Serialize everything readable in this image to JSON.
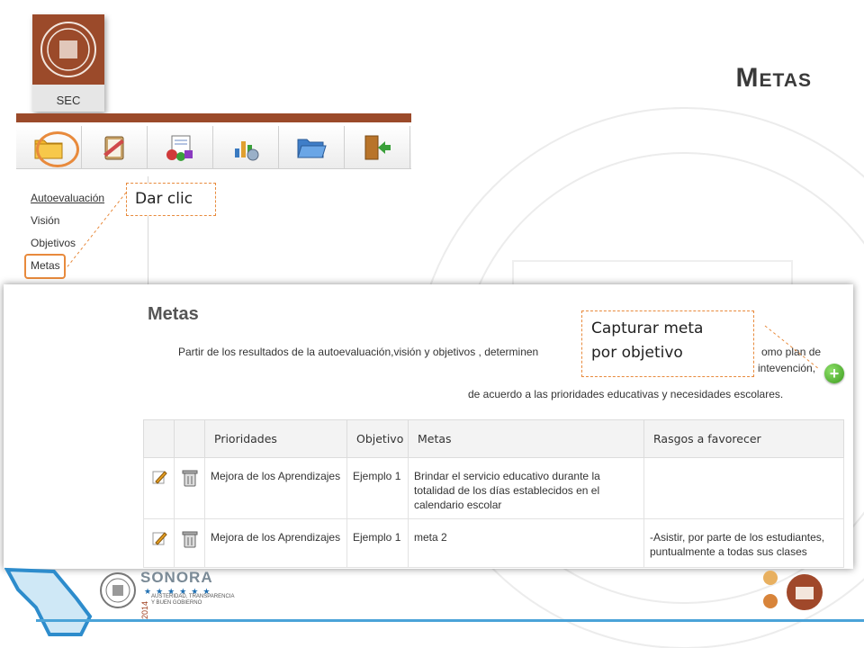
{
  "slide": {
    "title": "Metas"
  },
  "logo": {
    "label": "SEC"
  },
  "toolbar": {
    "items": [
      {
        "icon": "folder-icon",
        "active": true
      },
      {
        "icon": "clipboard-icon"
      },
      {
        "icon": "report-icon"
      },
      {
        "icon": "chart-icon"
      },
      {
        "icon": "open-folder-icon"
      },
      {
        "icon": "exit-door-icon"
      }
    ]
  },
  "left_menu": {
    "items": [
      "Autoevaluación",
      "Visión",
      "Objetivos",
      "Metas"
    ]
  },
  "callouts": {
    "dar_clic": "Dar clic",
    "capturar_line1": "Capturar meta",
    "capturar_line2": "por objetivo"
  },
  "panel": {
    "title": "Metas",
    "description_line1": "Partir de los resultados de la autoevaluación,visión y objetivos , determinen",
    "description_line1_end": "omo plan de",
    "description_line2_end": "intevención,",
    "description_line3": "de acuerdo a las prioridades educativas y necesidades escolares."
  },
  "table": {
    "headers": [
      "Prioridades",
      "Objetivo",
      "Metas",
      "Rasgos a favorecer"
    ],
    "rows": [
      {
        "prioridad": "Mejora de los Aprendizajes",
        "objetivo": "Ejemplo 1",
        "meta": "Brindar el servicio educativo durante la totalidad de los días establecidos en el calendario escolar",
        "rasgos": ""
      },
      {
        "prioridad": "Mejora de los Aprendizajes",
        "objetivo": "Ejemplo 1",
        "meta": "meta 2",
        "rasgos": "-Asistir, por parte de los estudiantes, puntualmente a todas sus clases"
      }
    ]
  },
  "footer": {
    "brand": "SONORA",
    "year": "2014",
    "slogan_line1": "AUSTERIDAD, TRANSPARENCIA",
    "slogan_line2": "Y BUEN GOBIERNO"
  },
  "colors": {
    "brand_brown": "#9b4a2a",
    "accent_orange": "#e88a3c",
    "footer_blue": "#4aa3d8"
  }
}
